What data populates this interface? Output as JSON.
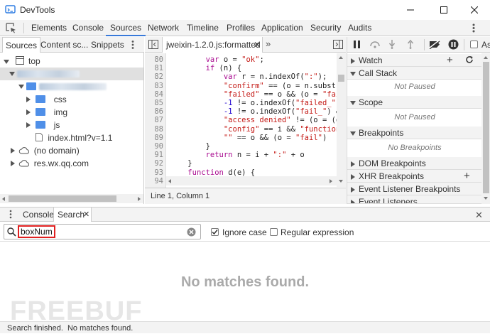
{
  "window": {
    "title": "DevTools"
  },
  "main_tabs": [
    "Elements",
    "Console",
    "Sources",
    "Network",
    "Timeline",
    "Profiles",
    "Application",
    "Security",
    "Audits"
  ],
  "active_main_tab": "Sources",
  "navigator": {
    "tabs": [
      "Sources",
      "Content sc...",
      "Snippets"
    ],
    "tree": {
      "top": "top",
      "css": "css",
      "img": "img",
      "js": "js",
      "index": "index.html?v=1.1",
      "no_domain": "(no domain)",
      "res": "res.wx.qq.com"
    }
  },
  "editor": {
    "file_tab": "jweixin-1.2.0.js:formatted",
    "status": "Line 1, Column 1",
    "line_numbers": [
      "80",
      "81",
      "82",
      "83",
      "84",
      "85",
      "86",
      "87",
      "88",
      "89",
      "90",
      "91",
      "92",
      "93",
      "94"
    ],
    "lines": [
      "        var o = \"ok\";",
      "        if (n) {",
      "            var r = n.indexOf(\":\");",
      "            \"confirm\" == (o = n.substrin",
      "            \"failed\" == o && (o = \"fail\"",
      "            -1 != o.indexOf(\"failed_\") &",
      "            -1 != o.indexOf(\"fail_\") &&",
      "            \"access denied\" != (o = (o =",
      "            \"config\" == i && \"function n",
      "            \"\" == o && (o = \"fail\")",
      "        }",
      "        return n = i + \":\" + o",
      "    }",
      "    function d(e) {",
      ""
    ]
  },
  "debugger": {
    "sections": {
      "watch": "Watch",
      "call_stack": "Call Stack",
      "not_paused_1": "Not Paused",
      "scope": "Scope",
      "not_paused_2": "Not Paused",
      "breakpoints": "Breakpoints",
      "no_breakpoints": "No Breakpoints",
      "dom_breakpoints": "DOM Breakpoints",
      "xhr_breakpoints": "XHR Breakpoints",
      "event_listener_breakpoints": "Event Listener Breakpoints",
      "event_listeners": "Event Listeners"
    },
    "async_label": "As"
  },
  "drawer": {
    "tabs": [
      "Console",
      "Search"
    ],
    "active_tab": "Search",
    "search": {
      "query": "boxNum",
      "ignore_case_label": "Ignore case",
      "ignore_case_checked": true,
      "regex_label": "Regular expression",
      "regex_checked": false
    },
    "no_matches": "No matches found.",
    "status": "Search finished.  No matches found.",
    "watermark": "FREEBUF"
  },
  "colors": {
    "accent": "#3879d9",
    "highlight_box": "#e02020",
    "folder_blue": "#4f8fe8",
    "folder_yellow": "#f4c245"
  }
}
